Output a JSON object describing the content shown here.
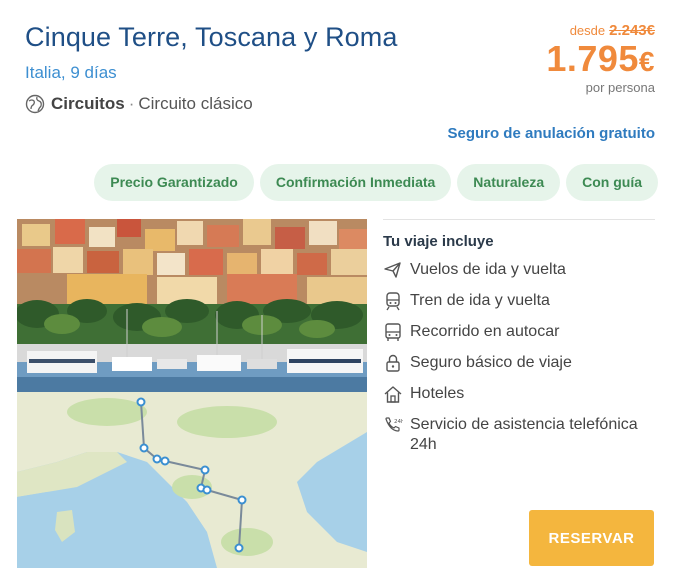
{
  "trip": {
    "title": "Cinque Terre, Toscana y Roma",
    "subtitle": "Italia, 9 días",
    "type_bold": "Circuitos",
    "type_sep": "·",
    "type_text": "Circuito clásico"
  },
  "price": {
    "from_label": "desde",
    "old_price": "2.243€",
    "amount": "1.795",
    "currency": "€",
    "per_label": "por persona"
  },
  "cancel_insurance": "Seguro de anulación gratuito",
  "tags": [
    "Precio Garantizado",
    "Confirmación Inmediata",
    "Naturaleza",
    "Con guía"
  ],
  "includes": {
    "heading": "Tu viaje incluye",
    "items": [
      {
        "icon": "plane-icon",
        "label": "Vuelos de ida y vuelta"
      },
      {
        "icon": "train-icon",
        "label": "Tren de ida y vuelta"
      },
      {
        "icon": "bus-icon",
        "label": "Recorrido en autocar"
      },
      {
        "icon": "lock-icon",
        "label": "Seguro básico de viaje"
      },
      {
        "icon": "house-icon",
        "label": "Hoteles"
      },
      {
        "icon": "phone-24h-icon",
        "label": "Servicio de asistencia telefónica 24h"
      }
    ]
  },
  "reserve_label": "RESERVAR",
  "colors": {
    "title": "#1f4f86",
    "accent_blue": "#3d8fd1",
    "price_orange": "#f08a3c",
    "tag_bg": "#e6f4ea",
    "tag_text": "#3d8a53",
    "reserve_bg": "#f4b63e"
  }
}
